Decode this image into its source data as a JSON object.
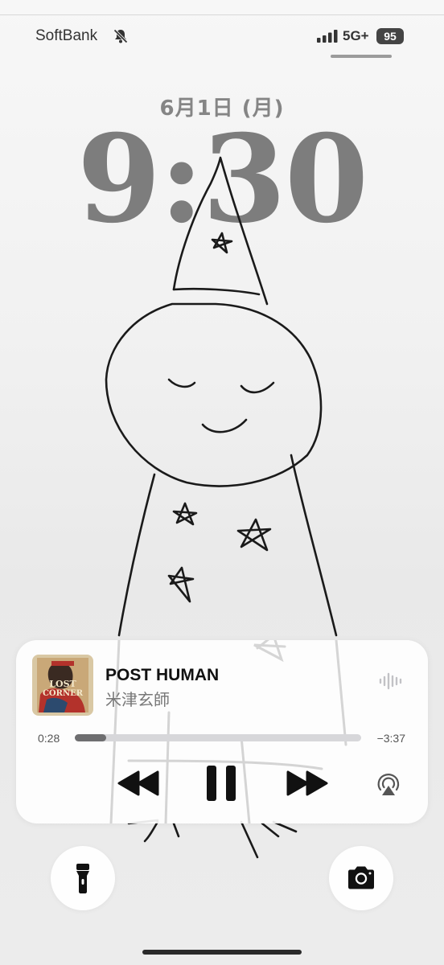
{
  "status_bar": {
    "carrier": "SoftBank",
    "network": "5G+",
    "battery": "95",
    "icons": [
      "bell-slash-icon",
      "signal-bars-icon"
    ]
  },
  "lock_screen": {
    "date": "6月1日 (月)",
    "time": "9:30"
  },
  "now_playing": {
    "title": "POST HUMAN",
    "artist": "米津玄師",
    "elapsed": "0:28",
    "remaining": "−3:37",
    "progress": 0.11,
    "artwork_text": "LOST CORNER",
    "controls": [
      "rewind-icon",
      "pause-icon",
      "fast-forward-icon",
      "airplay-icon"
    ]
  },
  "quick_actions": {
    "icons": [
      "flashlight-icon",
      "camera-icon"
    ]
  },
  "colors": {
    "clock": "#7d7d7d",
    "card_bg": "#ffffff",
    "progress_fill": "#6e6e70",
    "artwork_red": "#b3322b"
  }
}
